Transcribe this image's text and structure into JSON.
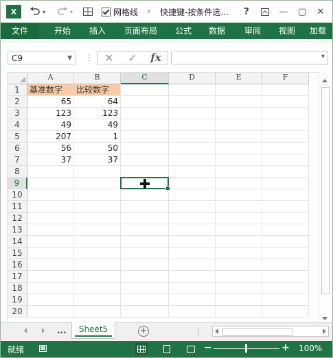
{
  "titlebar": {
    "app_icon": "excel-logo",
    "app_logo_text": "X",
    "undo_icon": "undo-icon",
    "redo_icon": "redo-icon",
    "gridlines_label": "网格线",
    "quick_access_more": "⩡",
    "title": "快捷键-按条件选...",
    "help": "?",
    "ribbon_display": "ribbon-display-icon",
    "minimize": "—",
    "restore": "▢",
    "close": "✕"
  },
  "ribbon": {
    "tabs": [
      "文件",
      "开始",
      "插入",
      "页面布局",
      "公式",
      "数据",
      "审阅",
      "视图",
      "加载"
    ]
  },
  "formula_bar": {
    "name_box": "C9",
    "cancel": "✕",
    "enter": "✓",
    "fx": "fx",
    "value": ""
  },
  "sheet": {
    "columns": [
      "A",
      "B",
      "C",
      "D",
      "E",
      "F"
    ],
    "rows": [
      "1",
      "2",
      "3",
      "4",
      "5",
      "6",
      "7",
      "8",
      "9",
      "10",
      "11",
      "12",
      "13",
      "14",
      "15",
      "16",
      "17",
      "18",
      "19",
      "20"
    ],
    "selected_cell": "C9",
    "header_row": [
      "基准数字",
      "比较数字"
    ],
    "data": [
      [
        "65",
        "64"
      ],
      [
        "123",
        "123"
      ],
      [
        "49",
        "49"
      ],
      [
        "207",
        "1"
      ],
      [
        "56",
        "50"
      ],
      [
        "37",
        "37"
      ]
    ],
    "header_fill": "#f8cba4"
  },
  "sheet_tabs": {
    "more": "...",
    "active": "Sheet5",
    "add": "+"
  },
  "status_bar": {
    "ready": "就绪",
    "zoom_minus": "−",
    "zoom_plus": "+",
    "zoom": "100%",
    "zoom_percent": 100
  },
  "colors": {
    "accent": "#217346",
    "ribbon": "#1f7245"
  }
}
